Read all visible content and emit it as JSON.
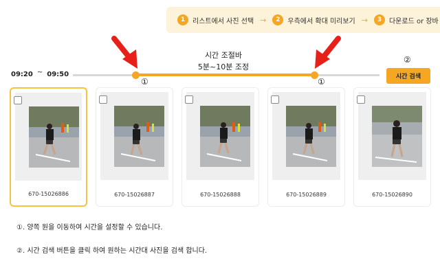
{
  "steps": [
    {
      "num": "1",
      "label": "리스트에서 사진 선택"
    },
    {
      "num": "2",
      "label": "우측에서 확대 미리보기"
    },
    {
      "num": "3",
      "label": "다운로드 or 장바"
    }
  ],
  "step_arrow": "→",
  "time_start": "09:20",
  "time_sep": "~",
  "time_end": "09:50",
  "slider_title_1": "시간 조절바",
  "slider_title_2": "5분~10분 조정",
  "circle_1": "①",
  "circle_2": "②",
  "search_button": "시간 검색",
  "cards": [
    {
      "id": "670-15026886",
      "selected": true
    },
    {
      "id": "670-15026887",
      "selected": false
    },
    {
      "id": "670-15026888",
      "selected": false
    },
    {
      "id": "670-15026889",
      "selected": false
    },
    {
      "id": "670-15026890",
      "selected": false
    }
  ],
  "notes": [
    "①. 양쪽 원을 이동하여 시간을 설정할 수 있습니다.",
    "②. 시간 검색 버튼을 클릭 하여 원하는 시간대 사진을 검색 합니다."
  ],
  "colors": {
    "accent": "#f5a623",
    "selected_border": "#f5c242",
    "red_arrow": "#e8201a"
  }
}
